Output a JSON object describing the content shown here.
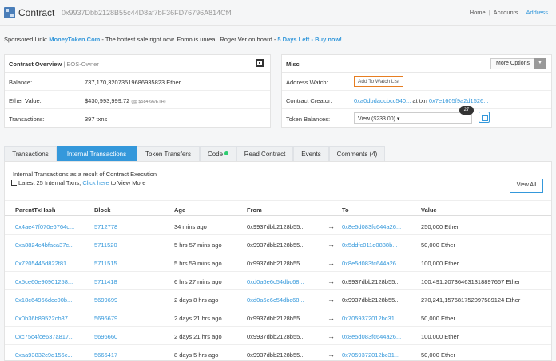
{
  "header": {
    "title": "Contract",
    "address": "0x9937Dbb2128B55c44D8af7bF36FD76796A814Cf4",
    "breadcrumbs": [
      "Home",
      "Accounts",
      "Address"
    ]
  },
  "sponsor": {
    "label": "Sponsored Link:",
    "site": "MoneyToken.Com",
    "text": " - The hottest sale right now. Fomo is unreal. Roger Ver on board - ",
    "cta": "5 Days Left - Buy now!"
  },
  "overview": {
    "title": "Contract Overview",
    "sep": " | ",
    "subtitle": "EOS-Owner",
    "balance_label": "Balance:",
    "balance_value": "737,170,32073519686935823 Ether",
    "ether_value_label": "Ether Value:",
    "ether_value": "$430,993,999.72",
    "ether_rate": "(@ $584.66/ETH)",
    "txns_label": "Transactions:",
    "txns_value": "397 txns"
  },
  "misc": {
    "title": "Misc",
    "more_options": "More Options",
    "watch_label": "Address Watch:",
    "watch_button": "Add To Watch List",
    "creator_label": "Contract Creator:",
    "creator_addr": "0xa0dbdadcbcc540...",
    "creator_at": " at txn ",
    "creator_txn": "0x7e1605f9a2d1526...",
    "tokens_label": "Token Balances:",
    "tokens_select": "View ($233.00) ▾",
    "tokens_count": "27"
  },
  "tabs": [
    {
      "label": "Transactions"
    },
    {
      "label": "Internal Transactions"
    },
    {
      "label": "Token Transfers"
    },
    {
      "label": "Code"
    },
    {
      "label": "Read Contract"
    },
    {
      "label": "Events"
    },
    {
      "label": "Comments (4)"
    }
  ],
  "internal": {
    "intro": "Internal Transactions as a result of Contract Execution",
    "latest_prefix": "Latest 25 Internal Txns, ",
    "latest_link": "Click here",
    "latest_suffix": " to View More",
    "view_all": "View All",
    "columns": [
      "ParentTxHash",
      "Block",
      "Age",
      "From",
      "To",
      "Value"
    ],
    "rows": [
      {
        "hash": "0x4ae47f070e6764c...",
        "block": "5712778",
        "age": "34 mins ago",
        "from": "0x9937dbb2128b55...",
        "from_link": false,
        "to": "0x8e5d083fc644a26...",
        "to_link": true,
        "value": "250,000 Ether"
      },
      {
        "hash": "0xa8824c4bfaca37c...",
        "block": "5711520",
        "age": "5 hrs 57 mins ago",
        "from": "0x9937dbb2128b55...",
        "from_link": false,
        "to": "0x5ddfc011d0888b...",
        "to_link": true,
        "value": "50,000 Ether"
      },
      {
        "hash": "0x7205445d822f81...",
        "block": "5711515",
        "age": "5 hrs 59 mins ago",
        "from": "0x9937dbb2128b55...",
        "from_link": false,
        "to": "0x8e5d083fc644a26...",
        "to_link": true,
        "value": "100,000 Ether"
      },
      {
        "hash": "0x5ce60e90901258...",
        "block": "5711418",
        "age": "6 hrs 27 mins ago",
        "from": "0xd0a6e6c54dbc68...",
        "from_link": true,
        "to": "0x9937dbb2128b55...",
        "to_link": false,
        "value": "100,491,207364631318897667 Ether"
      },
      {
        "hash": "0x18c64966dcc00b...",
        "block": "5699699",
        "age": "2 days 8 hrs ago",
        "from": "0xd0a6e6c54dbc68...",
        "from_link": true,
        "to": "0x9937dbb2128b55...",
        "to_link": false,
        "value": "270,241,157681752097589124 Ether"
      },
      {
        "hash": "0x0b36b89522cb87...",
        "block": "5696679",
        "age": "2 days 21 hrs ago",
        "from": "0x9937dbb2128b55...",
        "from_link": false,
        "to": "0x7059372012bc31...",
        "to_link": true,
        "value": "50,000 Ether"
      },
      {
        "hash": "0xc75c4fce637a817...",
        "block": "5696660",
        "age": "2 days 21 hrs ago",
        "from": "0x9937dbb2128b55...",
        "from_link": false,
        "to": "0x8e5d083fc644a26...",
        "to_link": true,
        "value": "100,000 Ether"
      },
      {
        "hash": "0xaa93832c9d156c...",
        "block": "5666417",
        "age": "8 days 5 hrs ago",
        "from": "0x9937dbb2128b55...",
        "from_link": false,
        "to": "0x7059372012bc31...",
        "to_link": true,
        "value": "50,000 Ether"
      }
    ]
  },
  "colors": {
    "link": "#3498db",
    "active_tab": "#3498db",
    "watch_border": "#e67e22",
    "code_badge": "#2ecc71"
  },
  "icons": {
    "logo": "contract-cube-icon",
    "qr": "qr-code-icon",
    "token_view": "token-view-icon",
    "arrow": "right-arrow-icon",
    "sort": "sort-icon"
  }
}
